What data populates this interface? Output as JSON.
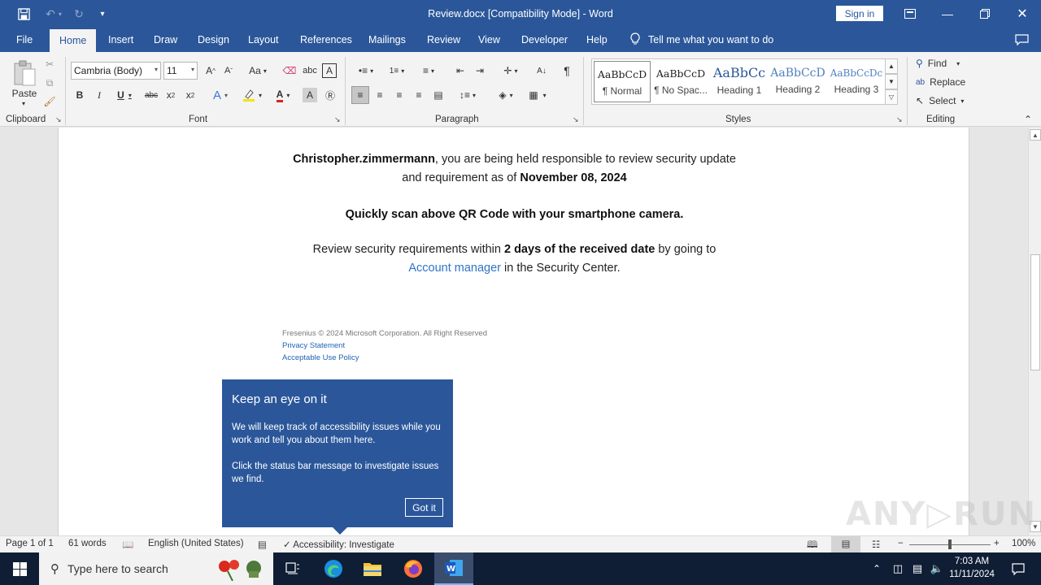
{
  "window": {
    "title": "Review.docx [Compatibility Mode]  -  Word",
    "sign_in": "Sign in"
  },
  "menu_tabs": [
    "File",
    "Home",
    "Insert",
    "Draw",
    "Design",
    "Layout",
    "References",
    "Mailings",
    "Review",
    "View",
    "Developer",
    "Help"
  ],
  "active_tab": "Home",
  "tell_me": "Tell me what you want to do",
  "ribbon": {
    "clipboard": {
      "label": "Clipboard",
      "paste": "Paste"
    },
    "font": {
      "label": "Font",
      "family": "Cambria (Body)",
      "size": "11",
      "color_accent": "#e02020",
      "highlight_accent": "#f5e400"
    },
    "paragraph": {
      "label": "Paragraph"
    },
    "styles": {
      "label": "Styles",
      "items": [
        {
          "preview": "AaBbCcD",
          "name": "¶ Normal"
        },
        {
          "preview": "AaBbCcD",
          "name": "¶ No Spac..."
        },
        {
          "preview": "AaBbCc",
          "name": "Heading 1"
        },
        {
          "preview": "AaBbCcD",
          "name": "Heading 2"
        },
        {
          "preview": "AaBbCcDc",
          "name": "Heading 3"
        }
      ]
    },
    "editing": {
      "label": "Editing",
      "find": "Find",
      "replace": "Replace",
      "select": "Select"
    }
  },
  "document": {
    "line1_name": "Christopher.zimmermann",
    "line1_rest": ", you are being held  responsible  to review security update",
    "line2_pre": "and requirement as of ",
    "line2_date": "November 08, 2024",
    "line3": "Quickly scan above QR Code with your smartphone camera.",
    "line4_pre": "Review security requirements within ",
    "line4_bold": "2 days of the received date",
    "line4_post": " by going to",
    "line5_link": "Account manager",
    "line5_post": " in the Security Center.",
    "footer_copyright": "Fresenius © 2024 Microsoft Corporation. All Right Reserved",
    "footer_privacy": "Privacy Statement",
    "footer_aup": "Acceptable Use Policy"
  },
  "callout": {
    "title": "Keep an eye on it",
    "text1": "We will keep track of accessibility issues while you work and tell you about them here.",
    "text2": "Click the status bar message to investigate issues we find.",
    "button": "Got it"
  },
  "status": {
    "page": "Page 1 of 1",
    "words": "61 words",
    "language": "English (United States)",
    "accessibility": "Accessibility: Investigate",
    "zoom": "100%",
    "zoom_level": 1.0
  },
  "taskbar": {
    "search_placeholder": "Type here to search",
    "time": "7:03 AM",
    "date": "11/11/2024"
  },
  "colors": {
    "word_blue": "#2b579a",
    "link_blue": "#2e74c6"
  }
}
